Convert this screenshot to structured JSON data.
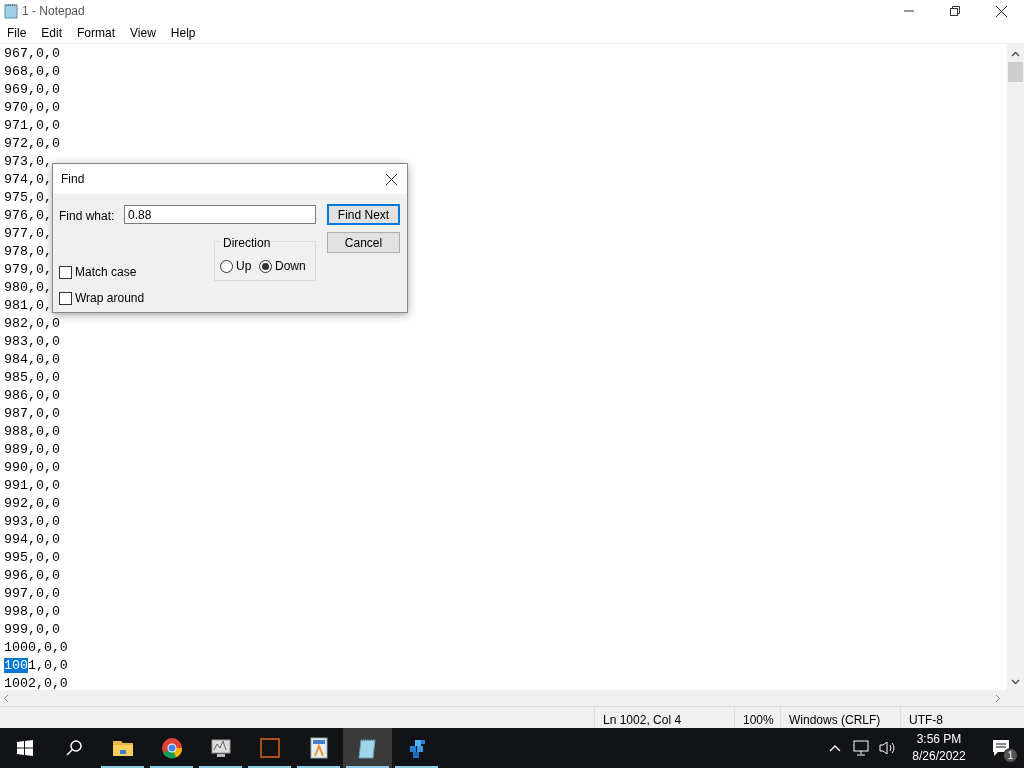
{
  "window": {
    "title": "1 - Notepad"
  },
  "menu": [
    "File",
    "Edit",
    "Format",
    "View",
    "Help"
  ],
  "lines": [
    {
      "text": "967,0,0"
    },
    {
      "text": "968,0,0"
    },
    {
      "text": "969,0,0"
    },
    {
      "text": "970,0,0"
    },
    {
      "text": "971,0,0"
    },
    {
      "text": "972,0,0"
    },
    {
      "text": "973,0,"
    },
    {
      "text": "974,0,"
    },
    {
      "text": "975,0,"
    },
    {
      "text": "976,0,"
    },
    {
      "text": "977,0,"
    },
    {
      "text": "978,0,"
    },
    {
      "text": "979,0,"
    },
    {
      "text": "980,0,"
    },
    {
      "text": "981,0,"
    },
    {
      "text": "982,0,0"
    },
    {
      "text": "983,0,0"
    },
    {
      "text": "984,0,0"
    },
    {
      "text": "985,0,0"
    },
    {
      "text": "986,0,0"
    },
    {
      "text": "987,0,0"
    },
    {
      "text": "988,0,0"
    },
    {
      "text": "989,0,0"
    },
    {
      "text": "990,0,0"
    },
    {
      "text": "991,0,0"
    },
    {
      "text": "992,0,0"
    },
    {
      "text": "993,0,0"
    },
    {
      "text": "994,0,0"
    },
    {
      "text": "995,0,0"
    },
    {
      "text": "996,0,0"
    },
    {
      "text": "997,0,0"
    },
    {
      "text": "998,0,0"
    },
    {
      "text": "999,0,0"
    },
    {
      "text": "1000,0,0"
    },
    {
      "highlight": "100",
      "text": "1,0,0"
    },
    {
      "text": "1002,0,0"
    }
  ],
  "find_dialog": {
    "title": "Find",
    "label": "Find what:",
    "value": "0.88",
    "find_next": "Find Next",
    "cancel": "Cancel",
    "direction_label": "Direction",
    "directions": [
      {
        "label": "Up",
        "selected": false
      },
      {
        "label": "Down",
        "selected": true
      }
    ],
    "options": [
      {
        "label": "Match case",
        "checked": false
      },
      {
        "label": "Wrap around",
        "checked": false
      }
    ]
  },
  "status_bar": [
    "Ln 1002, Col 4",
    "100%",
    "Windows (CRLF)",
    "UTF-8"
  ],
  "taskbar": {
    "apps": [
      {
        "kind": "folder",
        "running": true,
        "active": false
      },
      {
        "kind": "chrome",
        "running": true,
        "active": false
      },
      {
        "kind": "monitor",
        "running": true,
        "active": false
      },
      {
        "kind": "square",
        "running": true,
        "active": false
      },
      {
        "kind": "document",
        "running": true,
        "active": false
      },
      {
        "kind": "notepad",
        "running": true,
        "active": true
      },
      {
        "kind": "cubes",
        "running": true,
        "active": false
      }
    ],
    "time": "3:56 PM",
    "date": "8/26/2022",
    "notifications": "1"
  }
}
